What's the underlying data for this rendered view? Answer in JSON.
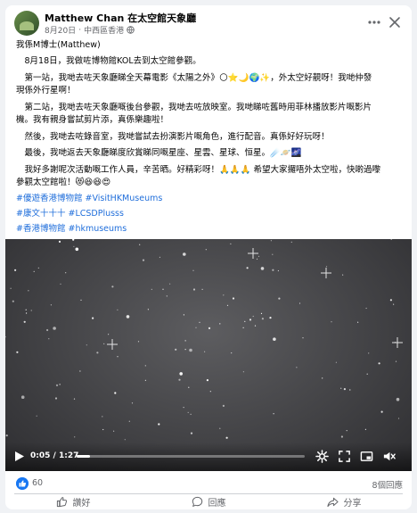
{
  "post": {
    "author": "Matthew Chan 在太空館天象廳",
    "date": "8月20日",
    "location": "中西區香港"
  },
  "body": {
    "lines": [
      "我係M博士(Matthew)",
      "　8月18日，我做咗博物館KOL去到太空館參觀。",
      "　第一站，我哋去咗天象廳睇全天幕電影《太陽之外》🌕⭐🌙🌍✨，外太空好靚呀！我哋仲發",
      "現係外行星啊！",
      "　第二站，我哋去咗天象廳嘅後台參觀，我哋去咗放映室。我哋睇咗舊時用菲林播放影片嘅影片",
      "機。我有親身嘗試剪片添，真係樂趣啦！",
      "　然後，我哋去咗錄音室，我哋嘗試去扮演影片嘅角色，進行配音。真係好好玩呀！",
      "　最後，我哋返去天象廳睇度欣賞睇同嘅星座、星雲、星球、恒星。☄️🪐🌌",
      "　我好多謝呢次活動嘅工作人員，辛苦晒。好精彩呀！🙏🙏🙏 希望大家攞唔外太空啦，快啲過嚟",
      "參觀太空館啦！😻😆😆😍"
    ],
    "hashtags": [
      "#優遊香港博物館 #VisitHKMuseums",
      "#康文十十十 #LCSDPlusss",
      "#香港博物館 #hkmuseums"
    ]
  },
  "video": {
    "current_time": "0:05",
    "duration": "1:27",
    "progress": 0.057
  },
  "stats": {
    "like_count": "60",
    "replies": "8個回應"
  },
  "actions": {
    "like": "讚好",
    "comment": "回應",
    "share": "分享"
  },
  "colors": {
    "brand_blue": "#1877f2",
    "hashtag": "#216fdb",
    "muted": "#65676b"
  }
}
